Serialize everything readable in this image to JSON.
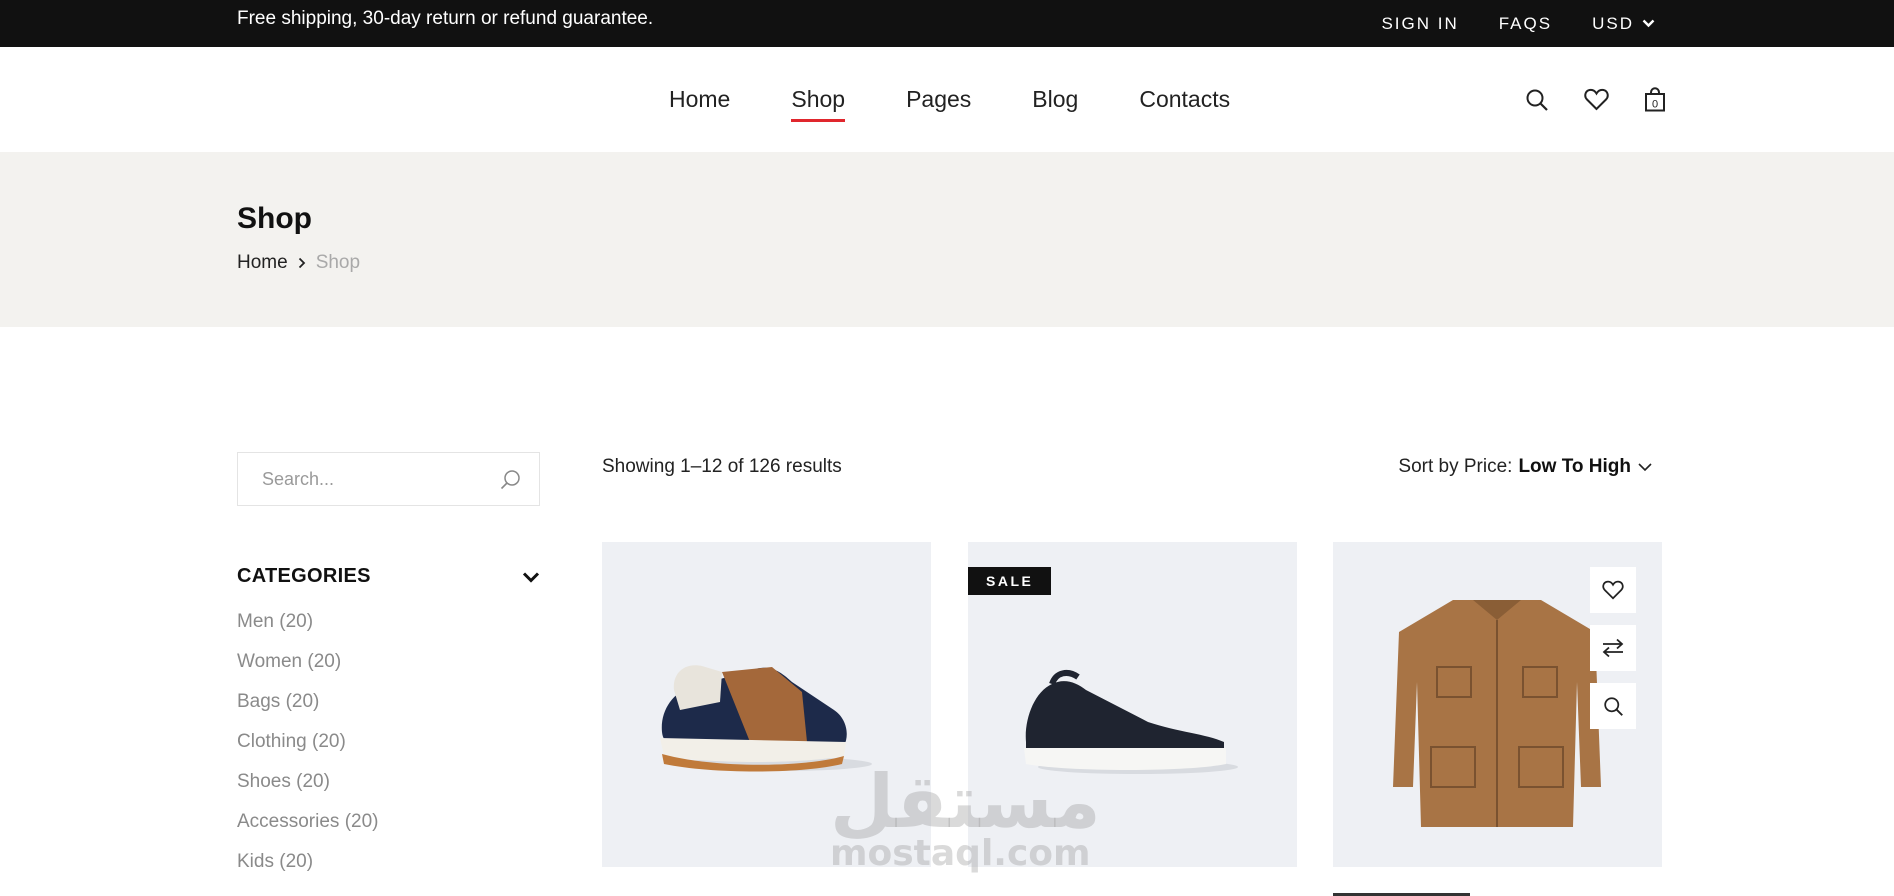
{
  "topbar": {
    "promo": "Free shipping, 30-day return or refund guarantee.",
    "sign_in": "SIGN IN",
    "faqs": "FAQS",
    "currency": "USD"
  },
  "nav": {
    "items": [
      {
        "label": "Home"
      },
      {
        "label": "Shop",
        "active": true
      },
      {
        "label": "Pages"
      },
      {
        "label": "Blog"
      },
      {
        "label": "Contacts"
      }
    ]
  },
  "header_icons": {
    "cart_count": "0"
  },
  "banner": {
    "title": "Shop",
    "breadcrumb": [
      "Home",
      "Shop"
    ]
  },
  "sidebar": {
    "search_placeholder": "Search...",
    "categories_title": "CATEGORIES",
    "categories": [
      {
        "label": "Men (20)"
      },
      {
        "label": "Women (20)"
      },
      {
        "label": "Bags (20)"
      },
      {
        "label": "Clothing (20)"
      },
      {
        "label": "Shoes (20)"
      },
      {
        "label": "Accessories (20)"
      },
      {
        "label": "Kids (20)"
      }
    ]
  },
  "listing": {
    "results_text": "Showing 1–12 of 126 results",
    "sort_prefix": "Sort by Price:",
    "sort_value": "Low To High"
  },
  "products": [
    {
      "image": "sneaker-navy-tan"
    },
    {
      "image": "sneaker-black",
      "badge": "SALE"
    },
    {
      "image": "jacket-tan"
    }
  ],
  "watermark": {
    "arabic": "مستقل",
    "latin": "mostaql.com"
  },
  "colors": {
    "topbar_bg": "#111111",
    "banner_bg": "#f3f2ef",
    "nav_active_underline": "#e0262d",
    "product_bg": "#eef0f4"
  }
}
